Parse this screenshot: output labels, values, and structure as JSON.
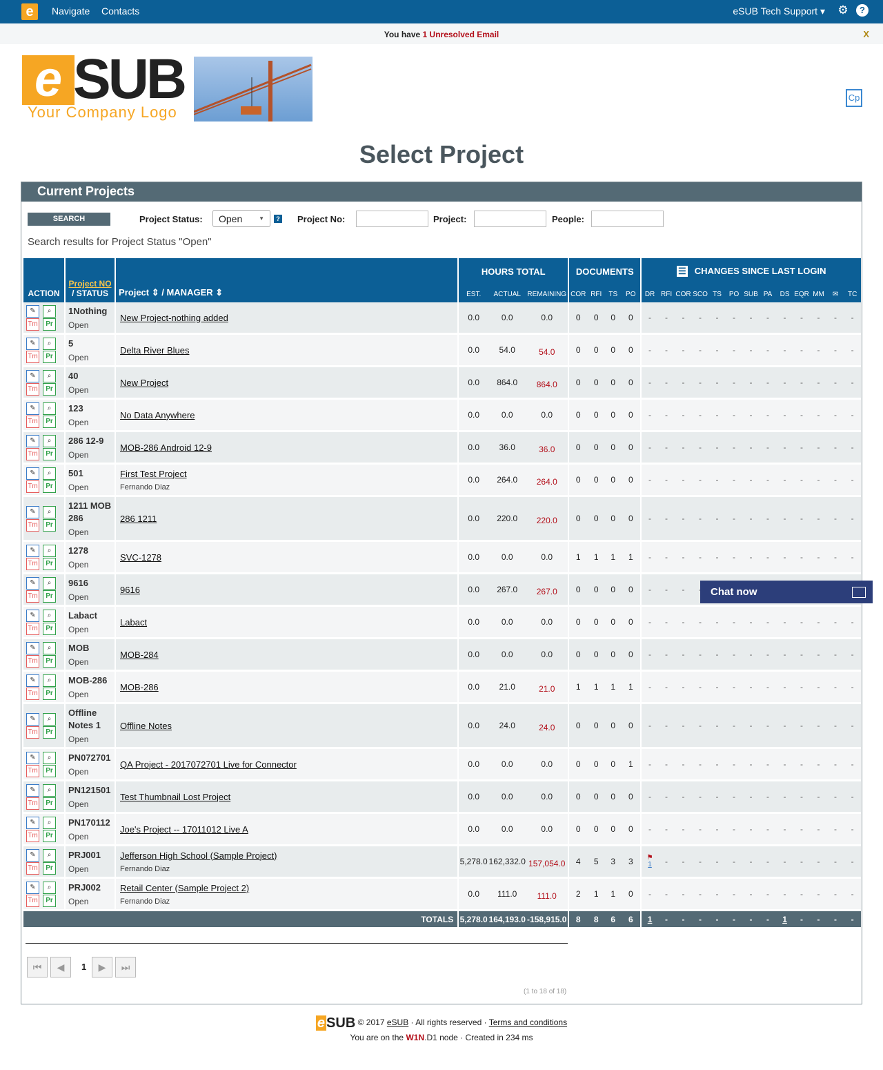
{
  "topbar": {
    "navigate": "Navigate",
    "contacts": "Contacts",
    "user": "eSUB Tech Support",
    "user_arrow": "▾"
  },
  "notice": {
    "prefix": "You have ",
    "count": "1 Unresolved Email",
    "close": "X"
  },
  "brand": {
    "e": "e",
    "sub": "SUB",
    "tagline": "Your Company Logo",
    "cp": "Cp"
  },
  "page": {
    "title": "Select Project"
  },
  "panel": {
    "title": "Current Projects"
  },
  "search": {
    "button": "SEARCH",
    "status_label": "Project Status:",
    "status_value": "Open",
    "projno_label": "Project No:",
    "project_label": "Project:",
    "people_label": "People:",
    "results": "Search results for Project Status \"Open\""
  },
  "table": {
    "h_action": "ACTION",
    "h_projno": "Project NO",
    "h_status": "/ STATUS",
    "h_project": "Project",
    "h_manager": "/ MANAGER",
    "h_hours": "HOURS TOTAL",
    "h_docs": "DOCUMENTS",
    "h_changes": "CHANGES SINCE LAST LOGIN",
    "h_est": "EST.",
    "h_actual": "ACTUAL",
    "h_remaining": "REMAINING",
    "doc_cols": [
      "COR",
      "RFI",
      "TS",
      "PO"
    ],
    "chg_cols": [
      "DR",
      "RFI",
      "COR",
      "SCO",
      "TS",
      "PO",
      "SUB",
      "PA",
      "DS",
      "EQR",
      "MM",
      "✉",
      "TC"
    ],
    "icon_tm": "Tm",
    "icon_pr": "Pr"
  },
  "rows": [
    {
      "no": "1Nothing",
      "status": "Open",
      "project": "New Project-nothing added",
      "manager": "",
      "est": "0.0",
      "actual": "0.0",
      "rem": "0.0",
      "rem_red": false,
      "docs": [
        "0",
        "0",
        "0",
        "0"
      ]
    },
    {
      "no": "5",
      "status": "Open",
      "project": "Delta River Blues",
      "manager": "",
      "est": "0.0",
      "actual": "54.0",
      "rem": "54.0",
      "rem_red": true,
      "docs": [
        "0",
        "0",
        "0",
        "0"
      ]
    },
    {
      "no": "40",
      "status": "Open",
      "project": "New Project",
      "manager": "",
      "est": "0.0",
      "actual": "864.0",
      "rem": "864.0",
      "rem_red": true,
      "docs": [
        "0",
        "0",
        "0",
        "0"
      ]
    },
    {
      "no": "123",
      "status": "Open",
      "project": "No Data Anywhere",
      "manager": "",
      "est": "0.0",
      "actual": "0.0",
      "rem": "0.0",
      "rem_red": false,
      "docs": [
        "0",
        "0",
        "0",
        "0"
      ]
    },
    {
      "no": "286 12-9",
      "status": "Open",
      "project": "MOB-286 Android 12-9",
      "manager": "",
      "est": "0.0",
      "actual": "36.0",
      "rem": "36.0",
      "rem_red": true,
      "docs": [
        "0",
        "0",
        "0",
        "0"
      ]
    },
    {
      "no": "501",
      "status": "Open",
      "project": "First Test Project",
      "manager": "Fernando Diaz",
      "est": "0.0",
      "actual": "264.0",
      "rem": "264.0",
      "rem_red": true,
      "docs": [
        "0",
        "0",
        "0",
        "0"
      ]
    },
    {
      "no": "1211 MOB 286",
      "status": "Open",
      "project": "286 1211",
      "manager": "",
      "est": "0.0",
      "actual": "220.0",
      "rem": "220.0",
      "rem_red": true,
      "docs": [
        "0",
        "0",
        "0",
        "0"
      ]
    },
    {
      "no": "1278",
      "status": "Open",
      "project": "SVC-1278",
      "manager": "",
      "est": "0.0",
      "actual": "0.0",
      "rem": "0.0",
      "rem_red": false,
      "docs": [
        "1",
        "1",
        "1",
        "1"
      ]
    },
    {
      "no": "9616",
      "status": "Open",
      "project": "9616",
      "manager": "",
      "est": "0.0",
      "actual": "267.0",
      "rem": "267.0",
      "rem_red": true,
      "docs": [
        "0",
        "0",
        "0",
        "0"
      ]
    },
    {
      "no": "Labact",
      "status": "Open",
      "project": "Labact",
      "manager": "",
      "est": "0.0",
      "actual": "0.0",
      "rem": "0.0",
      "rem_red": false,
      "docs": [
        "0",
        "0",
        "0",
        "0"
      ]
    },
    {
      "no": "MOB",
      "status": "Open",
      "project": "MOB-284",
      "manager": "",
      "est": "0.0",
      "actual": "0.0",
      "rem": "0.0",
      "rem_red": false,
      "docs": [
        "0",
        "0",
        "0",
        "0"
      ]
    },
    {
      "no": "MOB-286",
      "status": "Open",
      "project": "MOB-286",
      "manager": "",
      "est": "0.0",
      "actual": "21.0",
      "rem": "21.0",
      "rem_red": true,
      "docs": [
        "1",
        "1",
        "1",
        "1"
      ]
    },
    {
      "no": "Offline Notes 1",
      "status": "Open",
      "project": "Offline Notes",
      "manager": "",
      "est": "0.0",
      "actual": "24.0",
      "rem": "24.0",
      "rem_red": true,
      "docs": [
        "0",
        "0",
        "0",
        "0"
      ]
    },
    {
      "no": "PN072701",
      "status": "Open",
      "project": "QA Project - 2017072701 Live for Connector",
      "manager": "",
      "est": "0.0",
      "actual": "0.0",
      "rem": "0.0",
      "rem_red": false,
      "docs": [
        "0",
        "0",
        "0",
        "1"
      ]
    },
    {
      "no": "PN121501",
      "status": "Open",
      "project": "Test Thumbnail Lost Project",
      "manager": "",
      "est": "0.0",
      "actual": "0.0",
      "rem": "0.0",
      "rem_red": false,
      "docs": [
        "0",
        "0",
        "0",
        "0"
      ]
    },
    {
      "no": "PN170112",
      "status": "Open",
      "project": "Joe's Project -- 17011012 Live A",
      "manager": "",
      "est": "0.0",
      "actual": "0.0",
      "rem": "0.0",
      "rem_red": false,
      "docs": [
        "0",
        "0",
        "0",
        "0"
      ]
    },
    {
      "no": "PRJ001",
      "status": "Open",
      "project": "Jefferson High School (Sample Project)",
      "manager": "Fernando Diaz",
      "est": "5,278.0",
      "actual": "162,332.0",
      "rem": "157,054.0",
      "rem_red": true,
      "docs": [
        "4",
        "5",
        "3",
        "3"
      ],
      "dr_flag": "1"
    },
    {
      "no": "PRJ002",
      "status": "Open",
      "project": "Retail Center (Sample Project 2)",
      "manager": "Fernando Diaz",
      "est": "0.0",
      "actual": "111.0",
      "rem": "111.0",
      "rem_red": true,
      "docs": [
        "2",
        "1",
        "1",
        "0"
      ]
    }
  ],
  "totals": {
    "label": "TOTALS",
    "est": "5,278.0",
    "actual": "164,193.0",
    "rem": "-158,915.0",
    "docs": [
      "8",
      "8",
      "6",
      "6"
    ],
    "changes": [
      "1",
      "-",
      "-",
      "-",
      "-",
      "-",
      "-",
      "-",
      "1",
      "-",
      "-",
      "-",
      "-"
    ]
  },
  "pager": {
    "page": "1",
    "range": "(1 to 18 of 18)"
  },
  "footer": {
    "copy": "© 2017",
    "esub": "eSUB",
    "rights": " · All rights reserved · ",
    "terms": "Terms and conditions",
    "node_prefix": "You are on the ",
    "node_red": "W1N",
    "node_suffix": ".D1 node · Created in 234 ms"
  },
  "chat": {
    "label": "Chat now"
  },
  "colors": {
    "brand_blue": "#0c5f96",
    "header_gray": "#546a75",
    "accent_orange": "#f6a623",
    "alert_red": "#b30f1a"
  }
}
